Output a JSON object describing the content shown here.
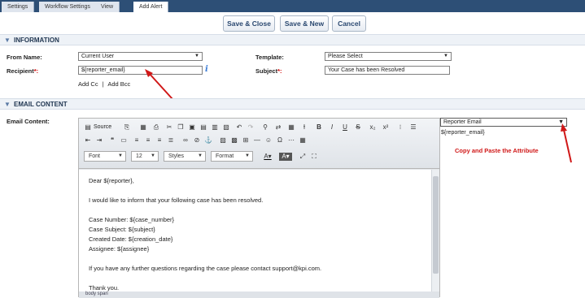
{
  "tabs": [
    {
      "label": "Settings",
      "active": false
    },
    {
      "label": "Workflow Settings",
      "active": false
    },
    {
      "label": "View",
      "active": false
    },
    {
      "label": "Add Alert",
      "active": true
    }
  ],
  "actions": {
    "save_close": "Save & Close",
    "save_new": "Save & New",
    "cancel": "Cancel"
  },
  "info_section": {
    "title": "INFORMATION",
    "from_name_label": "From Name:",
    "from_name_value": "Current User",
    "template_label": "Template:",
    "template_value": "Please Select",
    "recipient_label": "Recipient",
    "recipient_value": "${reporter_email}",
    "subject_label": "Subject",
    "subject_value": "Your Case has been Resolved",
    "add_cc": "Add Cc",
    "separator": "|",
    "add_bcc": "Add Bcc",
    "required_mark": "*:"
  },
  "email_section": {
    "title": "EMAIL CONTENT",
    "content_label": "Email Content:",
    "attribute_select": "Reporter Email",
    "attribute_value": "${reporter_email}",
    "annotation": "Copy and Paste the Attribute"
  },
  "editor": {
    "source_label": "Source",
    "combos": {
      "font": "Font",
      "size": "12",
      "styles": "Styles",
      "format": "Format"
    },
    "lines": [
      "Dear ${reporter},",
      "I would like to inform that your following case has been resolved.",
      "Case Number: ${case_number}",
      "Case Subject: ${subject}",
      "Created Date: ${creation_date}",
      "Assignee: ${assignee}",
      "If you have any further questions regarding the case please contact support@kpi.com.",
      "Thank you."
    ],
    "status": "body  span"
  },
  "icons": {
    "section_toggle": "chevron-down-icon",
    "info": "info-icon",
    "annotation_arrow": "red-arrow"
  },
  "colors": {
    "tabbar": "#2d4f76",
    "button_text": "#2a4870",
    "annotation": "#d01818",
    "section_bg": "#eef2f7"
  }
}
